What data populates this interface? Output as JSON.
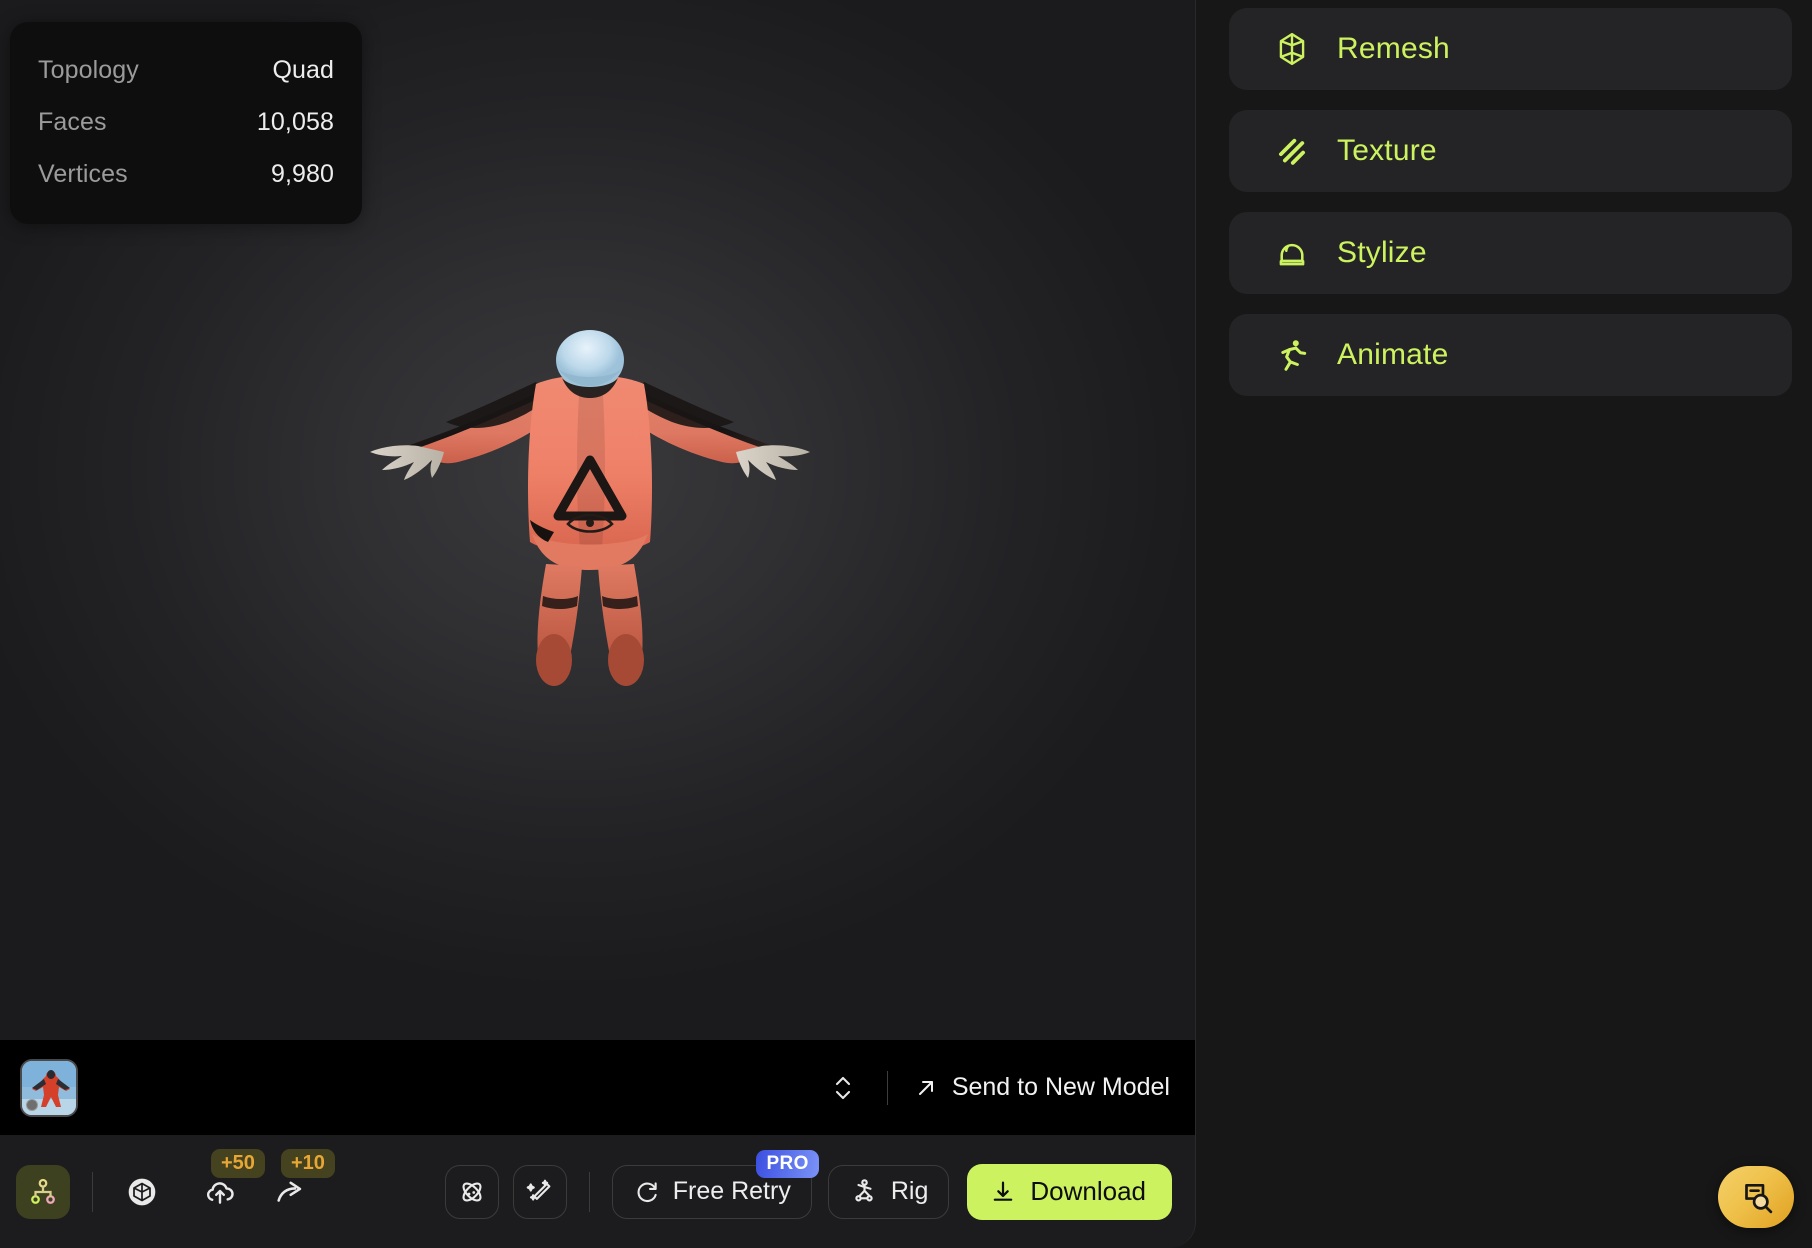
{
  "model_info": {
    "rows": [
      {
        "key": "Topology",
        "value": "Quad"
      },
      {
        "key": "Faces",
        "value": "10,058"
      },
      {
        "key": "Vertices",
        "value": "9,980"
      }
    ]
  },
  "viewport": {
    "model_description": "3D scanned wingsuit skydiver in orange-red suit with white helmet, arms outstretched",
    "background_color": "#303033"
  },
  "filmstrip": {
    "thumbnail_alt": "wingsuit skydiver photo thumbnail",
    "sort_icon": "chevron-up-down-icon",
    "send_icon": "arrow-up-right-icon",
    "send_label": "Send to New Model"
  },
  "toolbar": {
    "hierarchy_icon": "node-hierarchy-icon",
    "cube_icon": "cube-filled-icon",
    "upload_icon": "cloud-upload-icon",
    "upload_credit": "+50",
    "share_icon": "share-arrow-icon",
    "share_credit": "+10",
    "atom_icon": "atom-icon",
    "magic_icon": "magic-wand-sparkle-icon",
    "retry_icon": "refresh-icon",
    "retry_label": "Free Retry",
    "retry_badge": "PRO",
    "rig_icon": "skeleton-rig-icon",
    "rig_label": "Rig",
    "download_icon": "download-icon",
    "download_label": "Download",
    "download_color": "#cdf25f",
    "credit_color": "#e8a634",
    "pro_badge_color": "#5a72ef"
  },
  "sidebar": {
    "accent_color": "#cdf25f",
    "items": [
      {
        "label": "Remesh",
        "icon": "remesh-polyhedron-icon"
      },
      {
        "label": "Texture",
        "icon": "diagonal-stripes-icon"
      },
      {
        "label": "Stylize",
        "icon": "crystal-ball-icon"
      },
      {
        "label": "Animate",
        "icon": "running-person-icon"
      }
    ]
  },
  "help": {
    "icon": "document-search-icon",
    "color": "#efc14a"
  }
}
